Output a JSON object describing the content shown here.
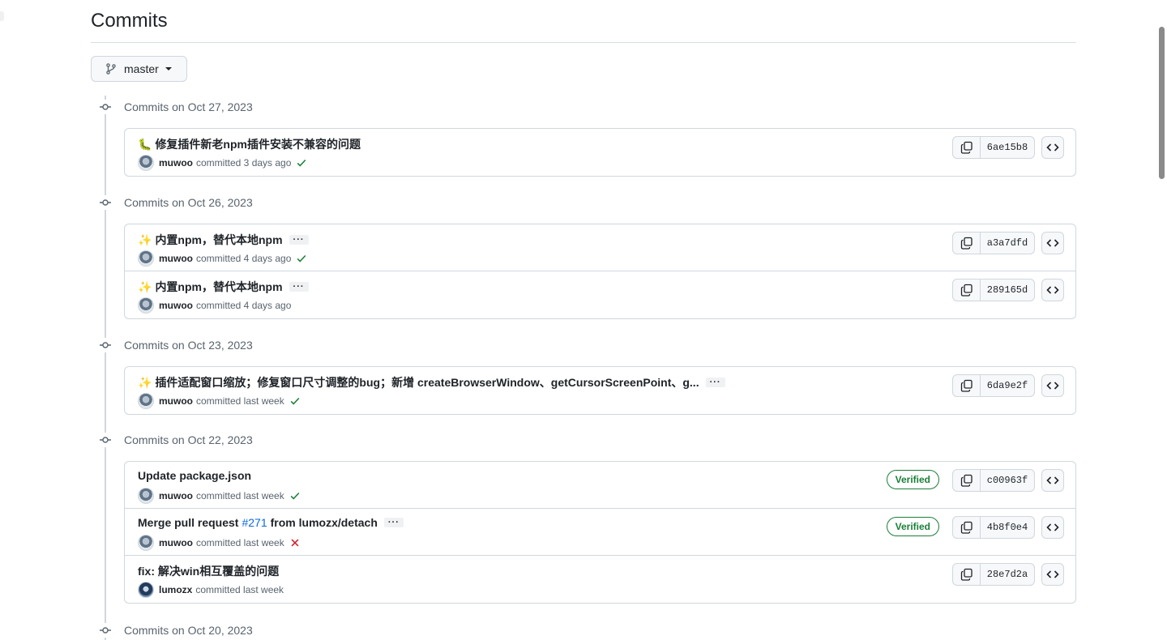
{
  "page": {
    "title": "Commits"
  },
  "branch": {
    "name": "master"
  },
  "groups": [
    {
      "label": "Commits on Oct 27, 2023",
      "commits": [
        {
          "emoji": "🐛",
          "message": "修复插件新老npm插件安装不兼容的问题",
          "author": "muwoo",
          "time": "committed 3 days ago",
          "status": "success",
          "sha": "6ae15b8"
        }
      ]
    },
    {
      "label": "Commits on Oct 26, 2023",
      "commits": [
        {
          "emoji": "✨",
          "message": "内置npm，替代本地npm",
          "more": "···",
          "author": "muwoo",
          "time": "committed 4 days ago",
          "status": "success",
          "sha": "a3a7dfd"
        },
        {
          "emoji": "✨",
          "message": "内置npm，替代本地npm",
          "more": "···",
          "author": "muwoo",
          "time": "committed 4 days ago",
          "sha": "289165d"
        }
      ]
    },
    {
      "label": "Commits on Oct 23, 2023",
      "commits": [
        {
          "emoji": "✨",
          "message": "插件适配窗口缩放；修复窗口尺寸调整的bug；新增 createBrowserWindow、getCursorScreenPoint、g...",
          "more": "···",
          "author": "muwoo",
          "time": "committed last week",
          "status": "success",
          "sha": "6da9e2f"
        }
      ]
    },
    {
      "label": "Commits on Oct 22, 2023",
      "commits": [
        {
          "message": "Update package.json",
          "author": "muwoo",
          "time": "committed last week",
          "status": "success",
          "verified": "Verified",
          "sha": "c00963f"
        },
        {
          "message_pre": "Merge pull request",
          "pr": "#271",
          "message_post": "from lumozx/detach",
          "more": "···",
          "author": "muwoo",
          "time": "committed last week",
          "status": "failure",
          "verified": "Verified",
          "sha": "4b8f0e4"
        },
        {
          "message": "fix: 解决win相互覆盖的问题",
          "author": "lumozx",
          "time": "committed last week",
          "sha": "28e7d2a"
        }
      ]
    },
    {
      "label": "Commits on Oct 20, 2023",
      "commits": []
    }
  ],
  "colors": {
    "success": "#1a7f37",
    "failure": "#cf222e",
    "link": "#0969da",
    "border": "#d0d7de"
  }
}
